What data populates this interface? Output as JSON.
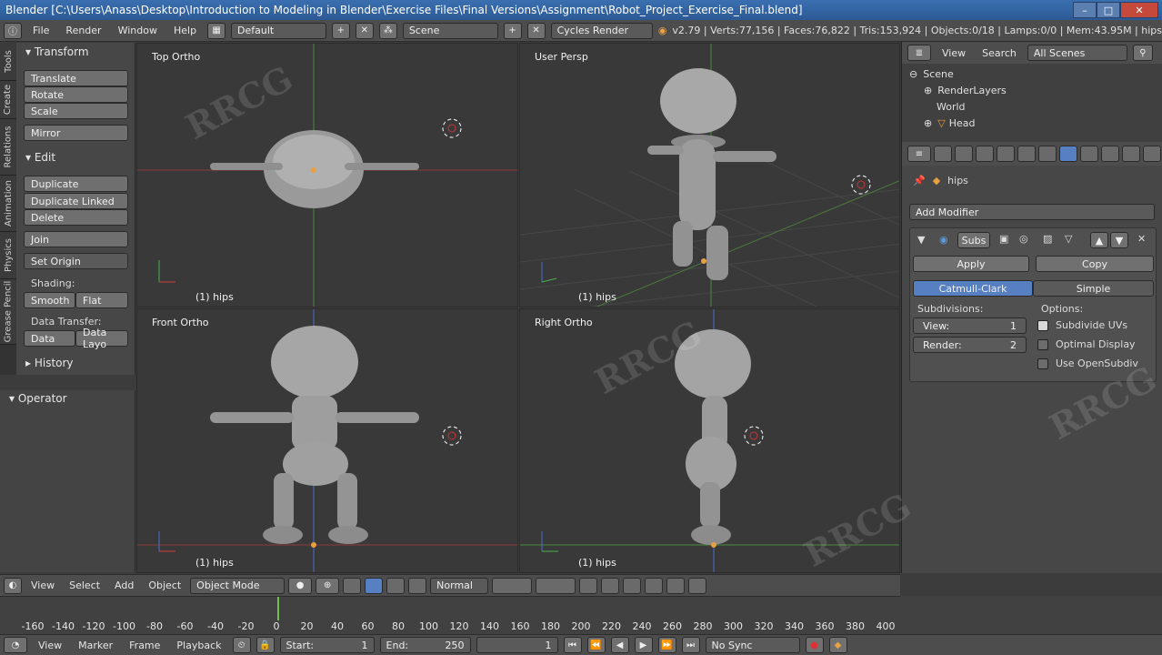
{
  "window": {
    "title": "Blender  [C:\\Users\\Anass\\Desktop\\Introduction to Modeling in Blender\\Exercise Files\\Final Versions\\Assignment\\Robot_Project_Exercise_Final.blend]",
    "minimize": "–",
    "maximize": "□",
    "close": "✕"
  },
  "info_header": {
    "menus": [
      "File",
      "Render",
      "Window",
      "Help"
    ],
    "screen_layout": "Default",
    "scene": "Scene",
    "render_engine": "Cycles Render",
    "stats": "v2.79 | Verts:77,156 | Faces:76,822 | Tris:153,924 | Objects:0/18 | Lamps:0/0 | Mem:43.95M | hips"
  },
  "tool_tabs": [
    "Tools",
    "Create",
    "Relations",
    "Animation",
    "Physics",
    "Grease Pencil"
  ],
  "toolshelf": {
    "transform_header": "Transform",
    "translate": "Translate",
    "rotate": "Rotate",
    "scale": "Scale",
    "mirror": "Mirror",
    "edit_header": "Edit",
    "duplicate": "Duplicate",
    "duplicate_linked": "Duplicate Linked",
    "delete": "Delete",
    "join": "Join",
    "set_origin": "Set Origin",
    "shading_label": "Shading:",
    "smooth": "Smooth",
    "flat": "Flat",
    "data_transfer_label": "Data Transfer:",
    "data": "Data",
    "data_layout": "Data Layo",
    "history_header": "History",
    "operator_header": "Operator"
  },
  "viewports": {
    "top_left": {
      "label": "Top Ortho",
      "object": "(1) hips"
    },
    "top_right": {
      "label": "User Persp",
      "object": "(1) hips"
    },
    "bottom_left": {
      "label": "Front Ortho",
      "object": "(1) hips"
    },
    "bottom_right": {
      "label": "Right Ortho",
      "object": "(1) hips"
    }
  },
  "view3d_header": {
    "menus": [
      "View",
      "Select",
      "Add",
      "Object"
    ],
    "mode": "Object Mode",
    "orientation": "Normal"
  },
  "outliner": {
    "view": "View",
    "search": "Search",
    "filter": "All Scenes",
    "rows": [
      "Scene",
      "RenderLayers",
      "World",
      "Head"
    ]
  },
  "properties": {
    "object_name": "hips",
    "add_modifier": "Add Modifier",
    "modifier_name": "Subs",
    "apply": "Apply",
    "copy": "Copy",
    "catmull": "Catmull-Clark",
    "simple": "Simple",
    "subdivisions_label": "Subdivisions:",
    "options_label": "Options:",
    "view_label": "View:",
    "view_value": "1",
    "render_label": "Render:",
    "render_value": "2",
    "subdivide_uvs": "Subdivide UVs",
    "optimal_display": "Optimal Display",
    "use_opensubdiv": "Use OpenSubdiv"
  },
  "timeline": {
    "ticks": [
      "-160",
      "-140",
      "-120",
      "-100",
      "-80",
      "-60",
      "-40",
      "-20",
      "0",
      "20",
      "40",
      "60",
      "80",
      "100",
      "120",
      "140",
      "160",
      "180",
      "200",
      "220",
      "240",
      "260",
      "280",
      "300",
      "320",
      "340",
      "360",
      "380",
      "400"
    ],
    "menus": [
      "View",
      "Marker",
      "Frame",
      "Playback"
    ],
    "start_label": "Start:",
    "start_value": "1",
    "end_label": "End:",
    "end_value": "250",
    "current_frame": "1",
    "sync": "No Sync"
  }
}
